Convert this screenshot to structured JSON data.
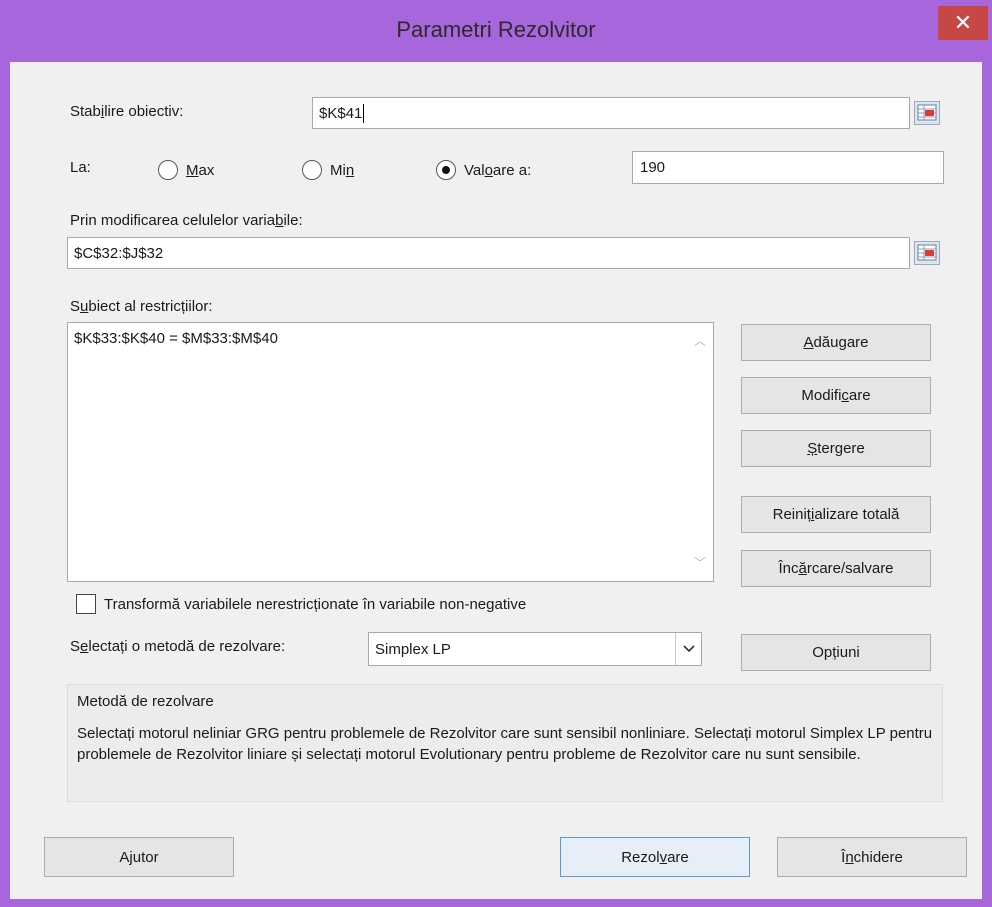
{
  "window": {
    "title": "Parametri Rezolvitor",
    "close_glyph": "✕"
  },
  "objective": {
    "label_pre": "Stab",
    "label_key": "i",
    "label_post": "lire obiectiv:",
    "value": "$K$41",
    "ref_icon": "collapse-dialog-icon"
  },
  "to": {
    "label": "La:",
    "max_key": "M",
    "max_rest": "ax",
    "min_pre": "Mi",
    "min_key": "n",
    "value_pre": "Val",
    "value_key": "o",
    "value_post": "are a:",
    "selected": "Valoare a:",
    "value": "190"
  },
  "variables": {
    "label_pre": "Prin modificarea celulelor varia",
    "label_key": "b",
    "label_post": "ile:",
    "value": "$C$32:$J$32",
    "ref_icon": "collapse-dialog-icon"
  },
  "constraints": {
    "label_pre": "S",
    "label_key": "u",
    "label_post": "biect al restricțiilor:",
    "items": [
      "$K$33:$K$40 = $M$33:$M$40"
    ]
  },
  "buttons": {
    "add_key": "A",
    "add_rest": "dăugare",
    "change_pre": "Modifi",
    "change_key": "c",
    "change_post": "are",
    "delete_key": "Ș",
    "delete_rest": "tergere",
    "reset_pre": "Reiniț",
    "reset_key": "i",
    "reset_post": "alizare totală",
    "load_pre": "Înc",
    "load_key": "ă",
    "load_post": "rcare/salvare",
    "options_pre": "Op",
    "options_key": "ț",
    "options_post": "iuni",
    "help_pre": "A",
    "help_key": "j",
    "help_post": "utor",
    "solve_pre": "Rezol",
    "solve_key": "v",
    "solve_post": "are",
    "close_pre": "Î",
    "close_key": "n",
    "close_post": "chidere"
  },
  "nonnegative": {
    "checked": false,
    "label_pre": "Transformă variabilele nerestricționate în variabile non-ne",
    "label_key": "g",
    "label_post": "ative"
  },
  "method": {
    "label_pre": "S",
    "label_key": "e",
    "label_post": "lectați o metodă de rezolvare:",
    "selected": "Simplex LP",
    "group_title": "Metodă de rezolvare",
    "description": "Selectați motorul neliniar GRG pentru problemele de Rezolvitor care sunt sensibil nonliniare. Selectați motorul Simplex LP pentru problemele de Rezolvitor liniare și selectați motorul Evolutionary pentru probleme de Rezolvitor care nu sunt sensibile."
  },
  "colors": {
    "titlebar": "#a866dc",
    "close": "#c74746",
    "client": "#f0f0f0"
  }
}
